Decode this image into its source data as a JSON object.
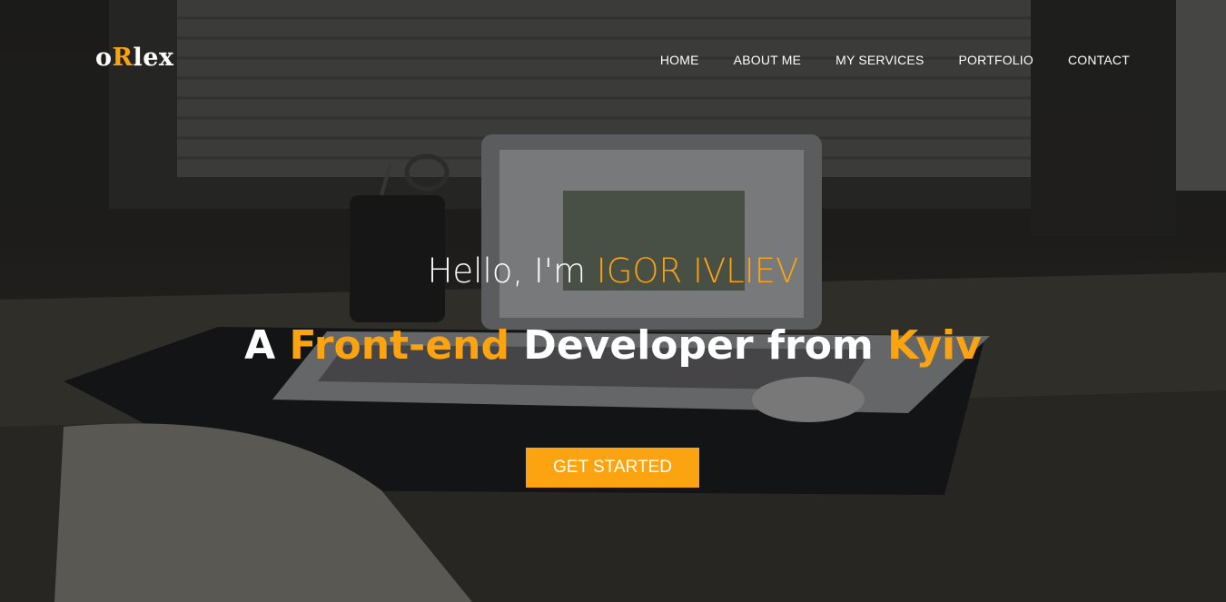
{
  "colors": {
    "accent": "#fca311",
    "text": "#ffffff"
  },
  "logo": {
    "part1": "o",
    "part2": "R",
    "part3": "lex"
  },
  "nav": {
    "items": [
      {
        "label": "HOME"
      },
      {
        "label": "ABOUT ME"
      },
      {
        "label": "MY SERVICES"
      },
      {
        "label": "PORTFOLIO"
      },
      {
        "label": "CONTACT"
      }
    ]
  },
  "hero": {
    "greeting_prefix": "Hello, I'm ",
    "name": "IGOR IVLIEV",
    "sub_a": "A ",
    "sub_role": "Front-end",
    "sub_b": " Developer from ",
    "sub_city": "Kyiv",
    "cta_label": "GET STARTED"
  }
}
